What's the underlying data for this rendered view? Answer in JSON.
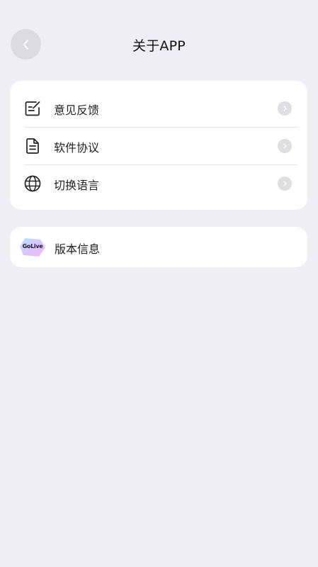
{
  "header": {
    "title": "关于APP",
    "back_icon": "chevron-left-icon"
  },
  "menu": {
    "items": [
      {
        "label": "意见反馈",
        "icon": "feedback-edit-icon"
      },
      {
        "label": "软件协议",
        "icon": "document-icon"
      },
      {
        "label": "切换语言",
        "icon": "globe-icon"
      }
    ]
  },
  "version": {
    "logo_text": "GoLive",
    "label": "版本信息"
  },
  "colors": {
    "background": "#efeef4",
    "card": "#ffffff",
    "chevron_bg": "#dedee3",
    "back_bg": "#dcdbe1"
  }
}
